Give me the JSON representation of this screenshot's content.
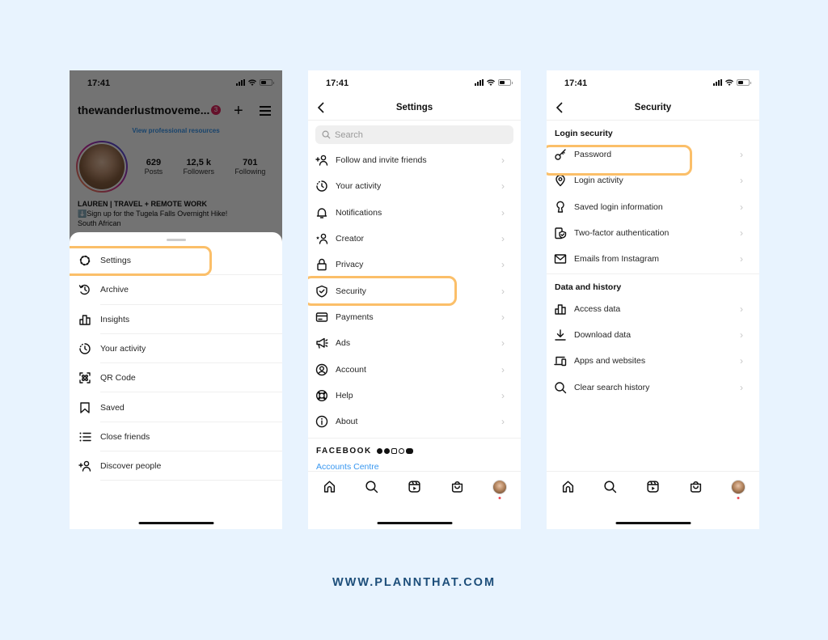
{
  "phones": [
    {
      "status": {
        "time": "17:41"
      },
      "profile": {
        "username": "thewanderlustmoveme...",
        "notifications": "3",
        "pro_link": "View professional resources",
        "stats": [
          {
            "num": "629",
            "label": "Posts"
          },
          {
            "num": "12,5 k",
            "label": "Followers"
          },
          {
            "num": "701",
            "label": "Following"
          }
        ],
        "bio_name": "LAUREN | TRAVEL + REMOTE WORK",
        "bio_line1": "⬇️Sign up for the Tugela Falls Overnight Hike!",
        "bio_line2": "South African"
      },
      "menu": [
        {
          "label": "Settings",
          "icon": "settings-gear-icon"
        },
        {
          "label": "Archive",
          "icon": "archive-icon"
        },
        {
          "label": "Insights",
          "icon": "insights-icon"
        },
        {
          "label": "Your activity",
          "icon": "activity-icon"
        },
        {
          "label": "QR Code",
          "icon": "qr-code-icon"
        },
        {
          "label": "Saved",
          "icon": "bookmark-icon"
        },
        {
          "label": "Close friends",
          "icon": "close-friends-icon"
        },
        {
          "label": "Discover people",
          "icon": "add-person-icon"
        }
      ]
    },
    {
      "status": {
        "time": "17:41"
      },
      "title": "Settings",
      "search_placeholder": "Search",
      "items": [
        {
          "label": "Follow and invite friends",
          "icon": "add-person-icon"
        },
        {
          "label": "Your activity",
          "icon": "activity-icon"
        },
        {
          "label": "Notifications",
          "icon": "bell-icon"
        },
        {
          "label": "Creator",
          "icon": "creator-icon"
        },
        {
          "label": "Privacy",
          "icon": "lock-icon"
        },
        {
          "label": "Security",
          "icon": "shield-icon"
        },
        {
          "label": "Payments",
          "icon": "card-icon"
        },
        {
          "label": "Ads",
          "icon": "megaphone-icon"
        },
        {
          "label": "Account",
          "icon": "account-icon"
        },
        {
          "label": "Help",
          "icon": "lifebuoy-icon"
        },
        {
          "label": "About",
          "icon": "info-icon"
        }
      ],
      "facebook_label": "FACEBOOK",
      "accounts_centre": "Accounts Centre"
    },
    {
      "status": {
        "time": "17:41"
      },
      "title": "Security",
      "sections": [
        {
          "heading": "Login security",
          "items": [
            {
              "label": "Password",
              "icon": "key-icon"
            },
            {
              "label": "Login activity",
              "icon": "location-pin-icon"
            },
            {
              "label": "Saved login information",
              "icon": "keyhole-icon"
            },
            {
              "label": "Two-factor authentication",
              "icon": "two-factor-icon"
            },
            {
              "label": "Emails from Instagram",
              "icon": "mail-icon"
            }
          ]
        },
        {
          "heading": "Data and history",
          "items": [
            {
              "label": "Access data",
              "icon": "insights-icon"
            },
            {
              "label": "Download data",
              "icon": "download-icon"
            },
            {
              "label": "Apps and websites",
              "icon": "devices-icon"
            },
            {
              "label": "Clear search history",
              "icon": "search-icon"
            }
          ]
        }
      ]
    }
  ],
  "footer": "WWW.PLANNTHAT.COM",
  "colors": {
    "background": "#e8f3fe",
    "highlight": "#fbbf69",
    "link": "#3897f0",
    "footer_text": "#1d4e7a"
  }
}
